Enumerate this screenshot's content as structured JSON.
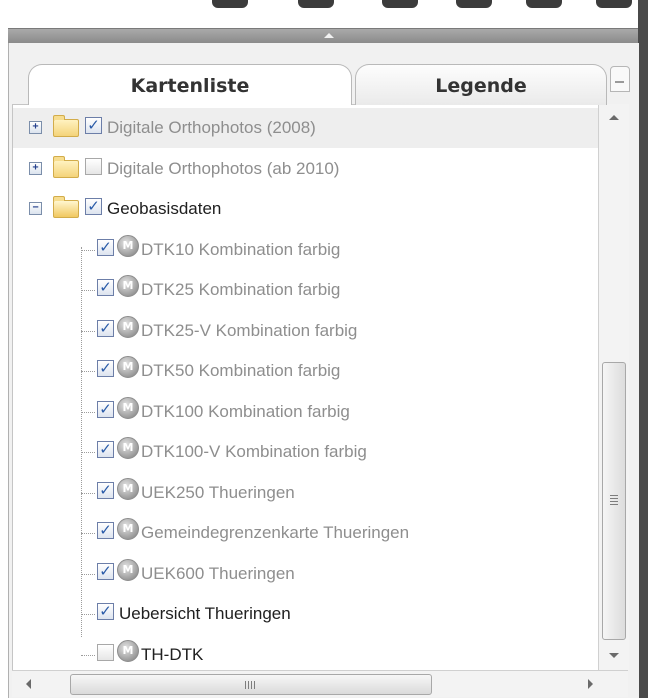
{
  "tabs": {
    "kartenliste": "Kartenliste",
    "legende": "Legende"
  },
  "tree": {
    "items": [
      {
        "label": "Digitale Orthophotos (2008)",
        "checked": true,
        "expander": "+",
        "folder": "closed",
        "style": "gray"
      },
      {
        "label": "Digitale Orthophotos (ab 2010)",
        "checked": false,
        "expander": "+",
        "folder": "closed",
        "style": "gray"
      },
      {
        "label": "Geobasisdaten",
        "checked": true,
        "expander": "−",
        "folder": "open",
        "style": "dark"
      },
      {
        "label": "DTK10 Kombination farbig",
        "checked": true,
        "m_icon": "M",
        "style": "gray"
      },
      {
        "label": "DTK25 Kombination farbig",
        "checked": true,
        "m_icon": "M",
        "style": "gray"
      },
      {
        "label": "DTK25-V Kombination farbig",
        "checked": true,
        "m_icon": "M",
        "style": "gray"
      },
      {
        "label": "DTK50 Kombination farbig",
        "checked": true,
        "m_icon": "M",
        "style": "gray"
      },
      {
        "label": "DTK100 Kombination farbig",
        "checked": true,
        "m_icon": "M",
        "style": "gray"
      },
      {
        "label": "DTK100-V Kombination farbig",
        "checked": true,
        "m_icon": "M",
        "style": "gray"
      },
      {
        "label": "UEK250 Thueringen",
        "checked": true,
        "m_icon": "M",
        "style": "gray"
      },
      {
        "label": "Gemeindegrenzenkarte Thueringen",
        "checked": true,
        "m_icon": "M",
        "style": "gray"
      },
      {
        "label": "UEK600 Thueringen",
        "checked": true,
        "m_icon": "M",
        "style": "gray"
      },
      {
        "label": "Uebersicht Thueringen",
        "checked": true,
        "style": "dark"
      },
      {
        "label": "TH-DTK",
        "checked": false,
        "m_icon": "M",
        "style": "dark"
      }
    ]
  },
  "icons": {
    "checkmark": "✓",
    "expand": "+",
    "collapse": "−"
  },
  "colors": {
    "check": "#2a5ba8",
    "expander": "#24408c",
    "folder": "#f4d37a",
    "splitter": "#8b8b8b"
  }
}
